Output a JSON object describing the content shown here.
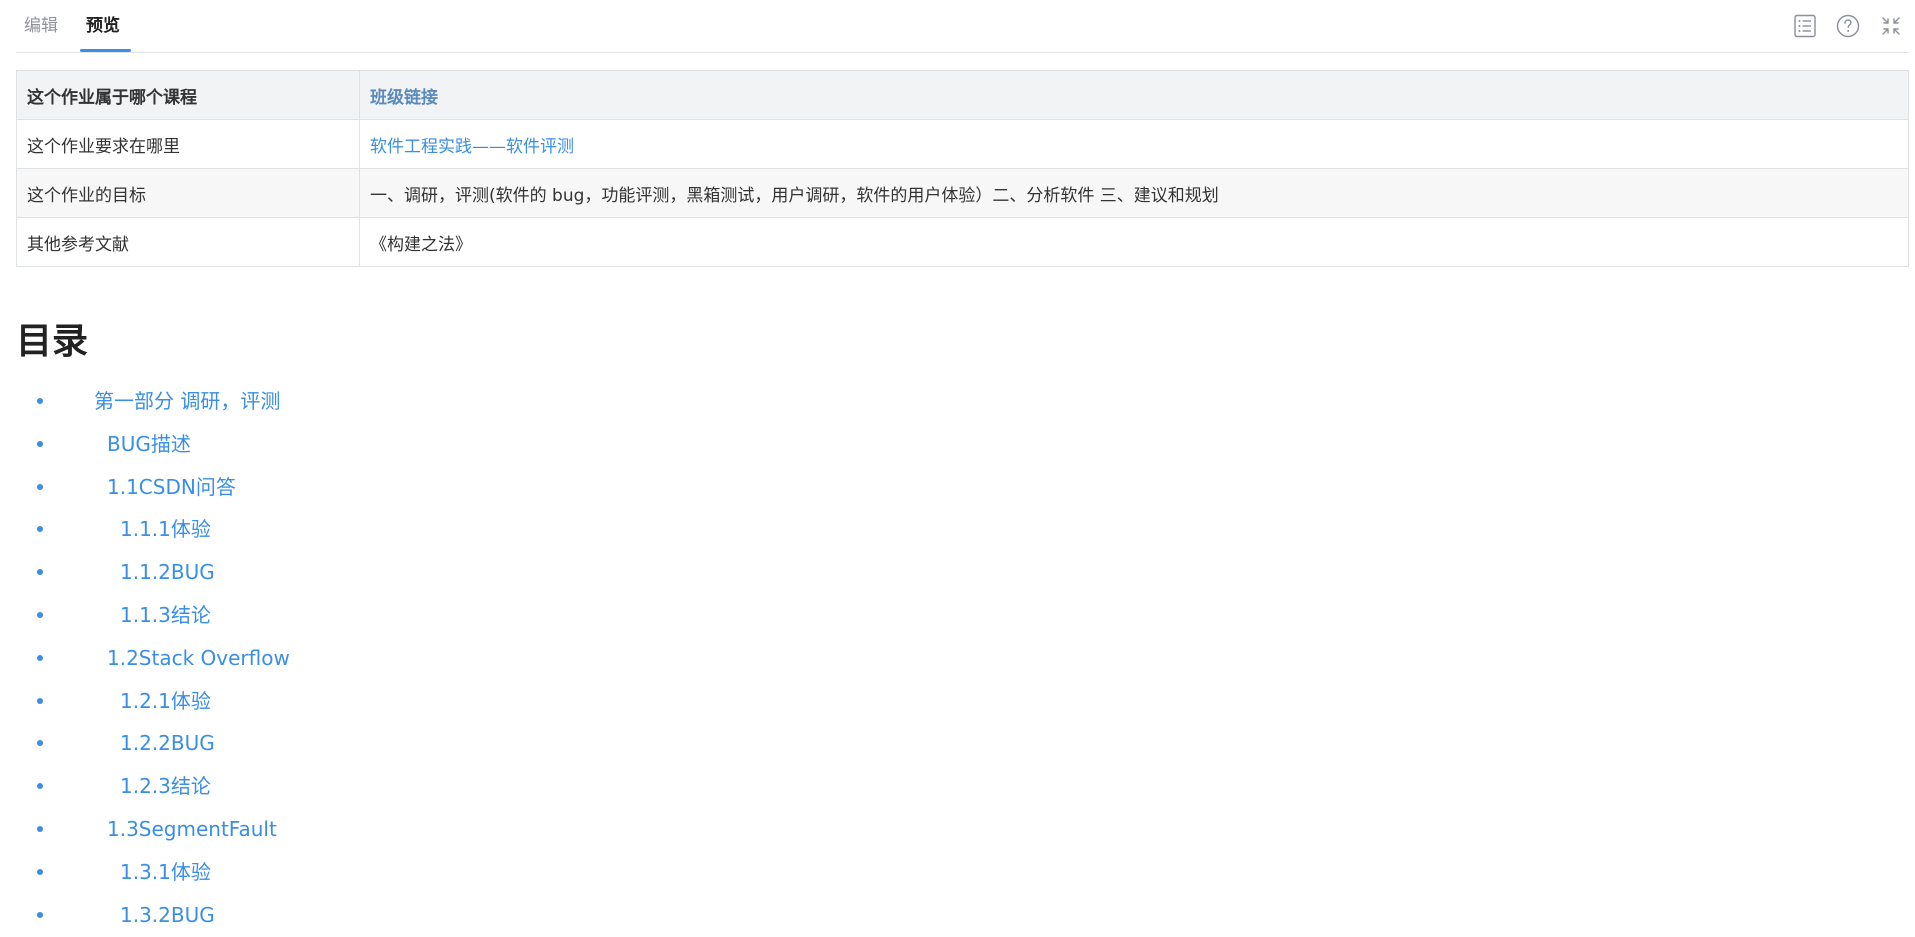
{
  "tabs": {
    "edit_label": "编辑",
    "preview_label": "预览",
    "active": "预览"
  },
  "toolbar": {
    "icons": [
      "toc-icon",
      "help-icon",
      "collapse-icon"
    ]
  },
  "colors": {
    "accent": "#3a8ee6",
    "header_link": "#5b8bbb",
    "border": "#dfe2e5"
  },
  "info_table": {
    "rows": [
      {
        "label": "这个作业属于哪个课程",
        "value": "班级链接",
        "is_link": true
      },
      {
        "label": "这个作业要求在哪里",
        "value": "软件工程实践——软件评测",
        "is_link": true
      },
      {
        "label": "这个作业的目标",
        "value": "一、调研，评测(软件的 bug，功能评测，黑箱测试，用户调研，软件的用户体验）二、分析软件 三、建议和规划",
        "is_link": false
      },
      {
        "label": "其他参考文献",
        "value": "《构建之法》",
        "is_link": false
      }
    ]
  },
  "toc": {
    "title": "目录",
    "items": [
      {
        "label": "第一部分 调研，评测",
        "level": 0
      },
      {
        "label": "BUG描述",
        "level": 1
      },
      {
        "label": "1.1CSDN问答",
        "level": 1
      },
      {
        "label": "1.1.1体验",
        "level": 2
      },
      {
        "label": "1.1.2BUG",
        "level": 2
      },
      {
        "label": "1.1.3结论",
        "level": 2
      },
      {
        "label": "1.2Stack Overflow",
        "level": 1
      },
      {
        "label": "1.2.1体验",
        "level": 2
      },
      {
        "label": "1.2.2BUG",
        "level": 2
      },
      {
        "label": "1.2.3结论",
        "level": 2
      },
      {
        "label": "1.3SegmentFault",
        "level": 1
      },
      {
        "label": "1.3.1体验",
        "level": 2
      },
      {
        "label": "1.3.2BUG",
        "level": 2
      }
    ]
  }
}
